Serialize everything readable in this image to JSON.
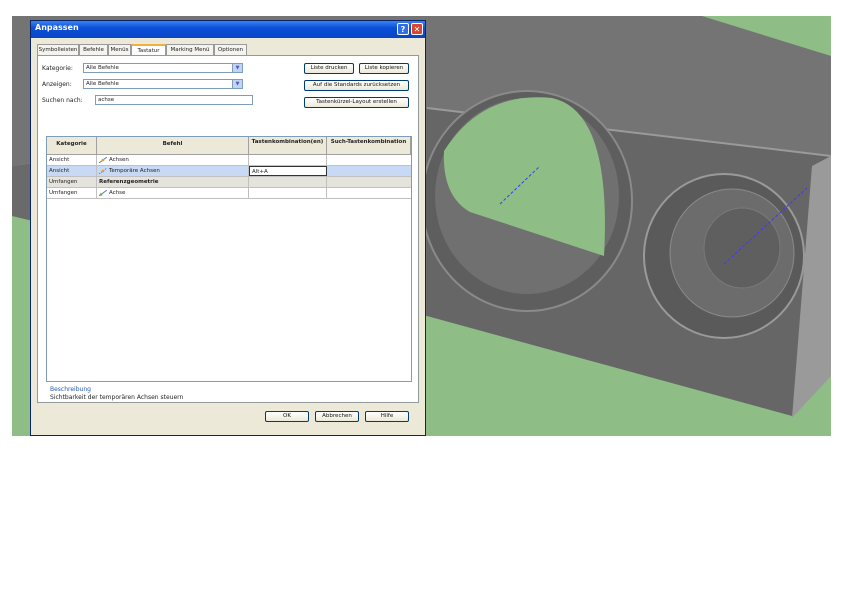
{
  "dialog": {
    "title": "Anpassen",
    "help_glyph": "?",
    "close_glyph": "✕"
  },
  "tabs": [
    {
      "label": "Symbolleisten"
    },
    {
      "label": "Befehle"
    },
    {
      "label": "Menüs"
    },
    {
      "label": "Tastatur"
    },
    {
      "label": "Marking Menü"
    },
    {
      "label": "Optionen"
    }
  ],
  "filters": {
    "category_label": "Kategorie:",
    "category_value": "Alle Befehle",
    "display_label": "Anzeigen:",
    "display_value": "Alle Befehle",
    "search_label": "Suchen nach:",
    "search_value": "achse"
  },
  "buttons": {
    "print_list": "Liste drucken",
    "copy_list": "Liste kopieren",
    "reset_all": "Auf die Standards zurücksetzen",
    "shortcut_layout": "Tastenkürzel-Layout erstellen",
    "ok": "OK",
    "cancel": "Abbrechen",
    "help": "Hilfe"
  },
  "table": {
    "headers": [
      "Kategorie",
      "Befehl",
      "Tastenkombination(en)",
      "Such-Tastenkombination"
    ],
    "rows": [
      {
        "category": "Ansicht",
        "command": "Achsen",
        "shortcut": "",
        "search": "",
        "type": "normal"
      },
      {
        "category": "Ansicht",
        "command": "Temporäre Achsen",
        "shortcut": "Alt+A",
        "search": "",
        "type": "selected"
      },
      {
        "category": "Umfangen",
        "command": "Referenzgeometrie",
        "shortcut": "",
        "search": "",
        "type": "group"
      },
      {
        "category": "Umfangen",
        "command": "Achse",
        "shortcut": "",
        "search": "",
        "type": "normal"
      }
    ]
  },
  "description": {
    "label": "Beschreibung",
    "text": "Sichtbarkeit der temporären Achsen steuern"
  },
  "colors": {
    "background_green": "#8fbd86",
    "part_gray": "#6a6a6a",
    "titlebar_blue": "#0c4fd8"
  }
}
